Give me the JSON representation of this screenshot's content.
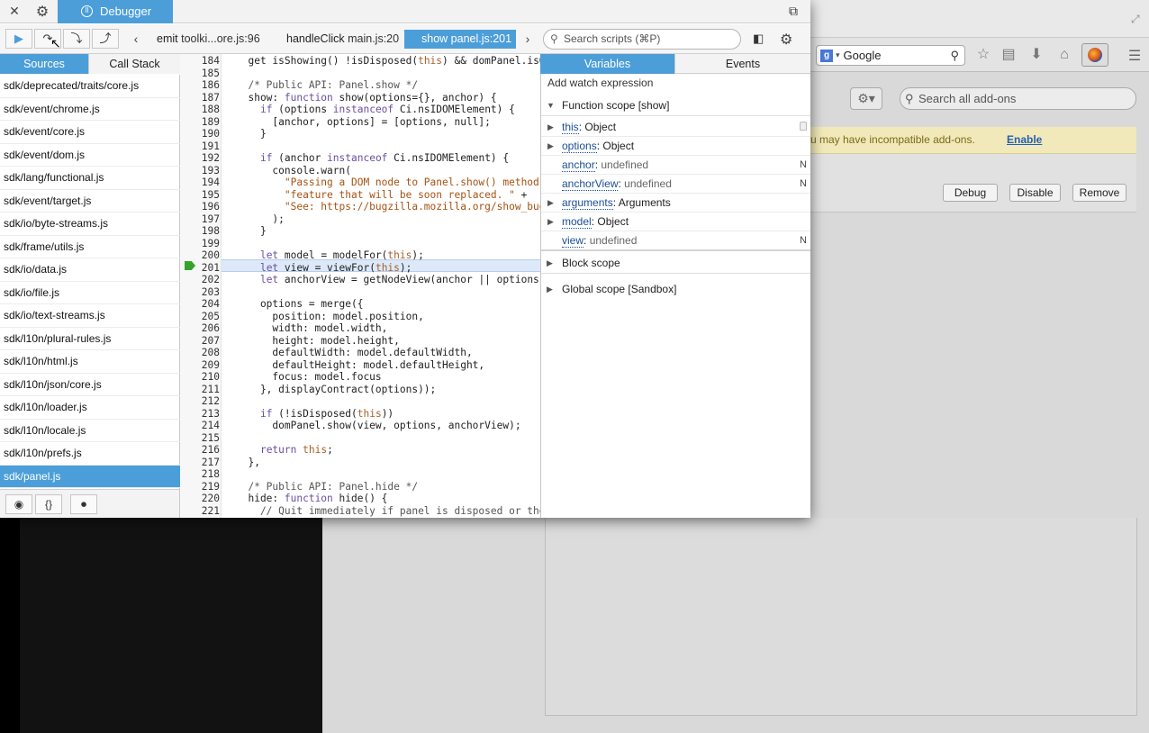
{
  "debugger": {
    "title": "Debugger",
    "toolbar": {
      "resume_icon": "resume-icon",
      "step_over_icon": "step-over-icon",
      "step_in_icon": "step-in-icon",
      "step_out_icon": "step-out-icon"
    },
    "breadcrumbs": [
      {
        "fn": "emit",
        "file": "toolki...ore.js:96"
      },
      {
        "fn": "handleClick",
        "file": "main.js:20"
      },
      {
        "fn": "show",
        "file": "panel.js:201"
      }
    ],
    "search_placeholder": "Search scripts (⌘P)",
    "sources_tab": "Sources",
    "callstack_tab": "Call Stack",
    "sources": [
      "sdk/deprecated/traits/core.js",
      "sdk/event/chrome.js",
      "sdk/event/core.js",
      "sdk/event/dom.js",
      "sdk/lang/functional.js",
      "sdk/event/target.js",
      "sdk/io/byte-streams.js",
      "sdk/frame/utils.js",
      "sdk/io/data.js",
      "sdk/io/file.js",
      "sdk/io/text-streams.js",
      "sdk/l10n/plural-rules.js",
      "sdk/l10n/html.js",
      "sdk/l10n/json/core.js",
      "sdk/l10n/loader.js",
      "sdk/l10n/locale.js",
      "sdk/l10n/prefs.js",
      "sdk/panel.js"
    ],
    "selected_source": "sdk/panel.js",
    "footer": {
      "prettify": "{}"
    },
    "code": {
      "current_line": 201,
      "lines": [
        {
          "n": "184",
          "t": "  get isShowing() !isDisposed(this) && domPanel.isOpen"
        },
        {
          "n": "185",
          "t": ""
        },
        {
          "n": "186",
          "t": "  /* Public API: Panel.show */"
        },
        {
          "n": "187",
          "t": "  show: function show(options={}, anchor) {"
        },
        {
          "n": "188",
          "t": "    if (options instanceof Ci.nsIDOMElement) {"
        },
        {
          "n": "189",
          "t": "      [anchor, options] = [options, null];"
        },
        {
          "n": "190",
          "t": "    }"
        },
        {
          "n": "191",
          "t": ""
        },
        {
          "n": "192",
          "t": "    if (anchor instanceof Ci.nsIDOMElement) {"
        },
        {
          "n": "193",
          "t": "      console.warn("
        },
        {
          "n": "194",
          "t": "        \"Passing a DOM node to Panel.show() method is an"
        },
        {
          "n": "195",
          "t": "        \"feature that will be soon replaced. \" +"
        },
        {
          "n": "196",
          "t": "        \"See: https://bugzilla.mozilla.org/show_bug.cgi"
        },
        {
          "n": "197",
          "t": "      );"
        },
        {
          "n": "198",
          "t": "    }"
        },
        {
          "n": "199",
          "t": ""
        },
        {
          "n": "200",
          "t": "    let model = modelFor(this);"
        },
        {
          "n": "201",
          "t": "    let view = viewFor(this);"
        },
        {
          "n": "202",
          "t": "    let anchorView = getNodeView(anchor || options.pos"
        },
        {
          "n": "203",
          "t": ""
        },
        {
          "n": "204",
          "t": "    options = merge({"
        },
        {
          "n": "205",
          "t": "      position: model.position,"
        },
        {
          "n": "206",
          "t": "      width: model.width,"
        },
        {
          "n": "207",
          "t": "      height: model.height,"
        },
        {
          "n": "208",
          "t": "      defaultWidth: model.defaultWidth,"
        },
        {
          "n": "209",
          "t": "      defaultHeight: model.defaultHeight,"
        },
        {
          "n": "210",
          "t": "      focus: model.focus"
        },
        {
          "n": "211",
          "t": "    }, displayContract(options));"
        },
        {
          "n": "212",
          "t": ""
        },
        {
          "n": "213",
          "t": "    if (!isDisposed(this))"
        },
        {
          "n": "214",
          "t": "      domPanel.show(view, options, anchorView);"
        },
        {
          "n": "215",
          "t": ""
        },
        {
          "n": "216",
          "t": "    return this;"
        },
        {
          "n": "217",
          "t": "  },"
        },
        {
          "n": "218",
          "t": ""
        },
        {
          "n": "219",
          "t": "  /* Public API: Panel.hide */"
        },
        {
          "n": "220",
          "t": "  hide: function hide() {"
        },
        {
          "n": "221",
          "t": "    // Quit immediately if panel is disposed or there"
        }
      ]
    },
    "variables_tab": "Variables",
    "events_tab": "Events",
    "watch_label": "Add watch expression",
    "function_scope": "Function scope [show]",
    "variables": [
      {
        "name": "this",
        "value": "Object",
        "expandable": true,
        "flag": ""
      },
      {
        "name": "options",
        "value": "Object",
        "expandable": true,
        "flag": ""
      },
      {
        "name": "anchor",
        "value": "undefined",
        "expandable": false,
        "flag": "N"
      },
      {
        "name": "anchorView",
        "value": "undefined",
        "expandable": false,
        "flag": "N"
      },
      {
        "name": "arguments",
        "value": "Arguments",
        "expandable": true,
        "flag": ""
      },
      {
        "name": "model",
        "value": "Object",
        "expandable": true,
        "flag": ""
      },
      {
        "name": "view",
        "value": "undefined",
        "expandable": false,
        "flag": "N"
      }
    ],
    "block_scope": "Block scope",
    "global_scope": "Global scope [Sandbox]"
  },
  "browser": {
    "search_engine": "Google",
    "addon_search_placeholder": "Search all add-ons",
    "notice_text": "u may have incompatible add-ons.",
    "notice_link": "Enable",
    "buttons": {
      "debug": "Debug",
      "disable": "Disable",
      "remove": "Remove"
    }
  },
  "colors": {
    "accent": "#4c9ed9",
    "breakpoint": "#34a32a",
    "notice_bg": "#f1e9b9"
  }
}
